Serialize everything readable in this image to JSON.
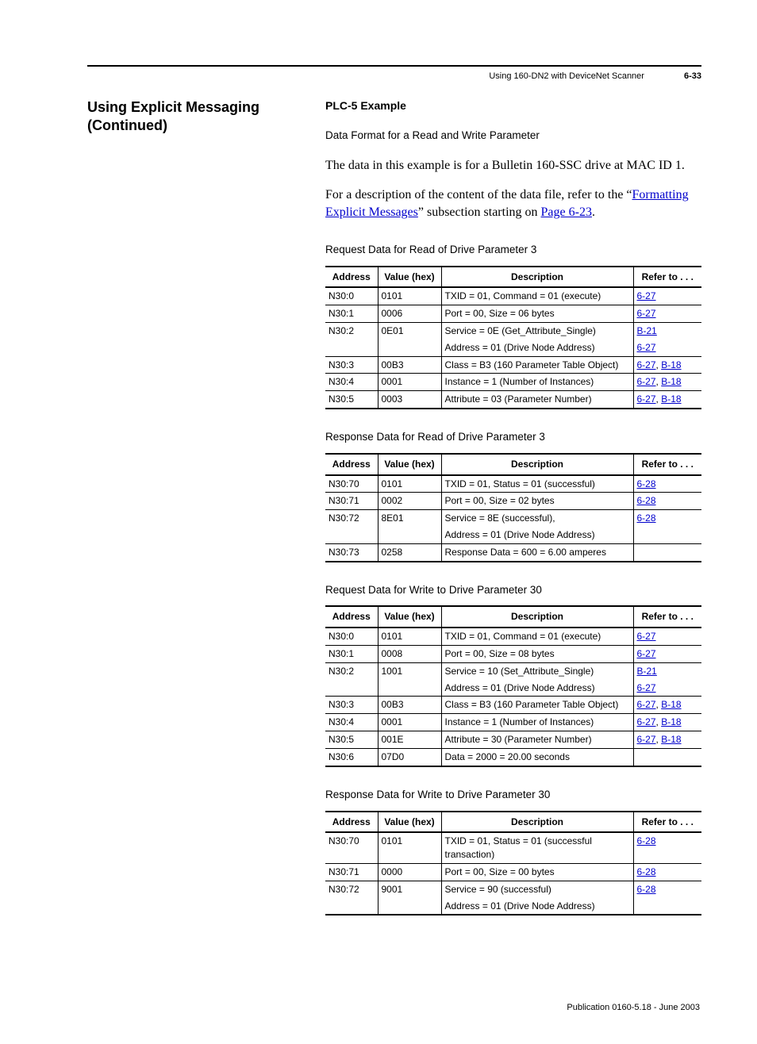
{
  "header": {
    "title": "Using 160-DN2 with DeviceNet Scanner",
    "page_number": "6-33"
  },
  "section_heading": "Using Explicit Messaging (Continued)",
  "subheading": "PLC-5 Example",
  "intro_sans": "Data Format for a Read and Write Parameter",
  "para1": "The data in this example is for a Bulletin 160-SSC drive at MAC ID 1.",
  "para2_pre": "For a description of the content of the data file, refer to the “",
  "para2_link1": "Formatting Explicit Messages",
  "para2_mid": "” subsection starting on ",
  "para2_link2": "Page 6-23",
  "para2_end": ".",
  "col_headers": {
    "address": "Address",
    "value": "Value (hex)",
    "description": "Description",
    "refer": "Refer to . . ."
  },
  "tables": [
    {
      "caption": "Request Data for Read of Drive Parameter 3",
      "rows": [
        {
          "address": "N30:0",
          "value": "0101",
          "description": "TXID = 01, Command = 01 (execute)",
          "refs": [
            "6-27"
          ]
        },
        {
          "address": "N30:1",
          "value": "0006",
          "description": "Port = 00, Size = 06 bytes",
          "refs": [
            "6-27"
          ]
        },
        {
          "address": "N30:2",
          "value": "0E01",
          "description": "Service = 0E (Get_Attribute_Single)",
          "refs": [
            "B-21"
          ]
        },
        {
          "address": "",
          "value": "",
          "description": "Address = 01 (Drive Node Address)",
          "refs": [
            "6-27"
          ],
          "cont": true
        },
        {
          "address": "N30:3",
          "value": "00B3",
          "description": "Class = B3 (160 Parameter Table Object)",
          "refs": [
            "6-27",
            "B-18"
          ]
        },
        {
          "address": "N30:4",
          "value": "0001",
          "description": "Instance = 1 (Number of Instances)",
          "refs": [
            "6-27",
            "B-18"
          ]
        },
        {
          "address": "N30:5",
          "value": "0003",
          "description": "Attribute = 03 (Parameter Number)",
          "refs": [
            "6-27",
            "B-18"
          ]
        }
      ]
    },
    {
      "caption": "Response Data for Read of Drive Parameter 3",
      "rows": [
        {
          "address": "N30:70",
          "value": "0101",
          "description": "TXID = 01, Status = 01 (successful)",
          "refs": [
            "6-28"
          ]
        },
        {
          "address": "N30:71",
          "value": "0002",
          "description": "Port = 00, Size = 02 bytes",
          "refs": [
            "6-28"
          ]
        },
        {
          "address": "N30:72",
          "value": "8E01",
          "description": "Service = 8E (successful),",
          "refs": [
            "6-28"
          ]
        },
        {
          "address": "",
          "value": "",
          "description": "Address = 01 (Drive Node Address)",
          "refs": [],
          "cont": true
        },
        {
          "address": "N30:73",
          "value": "0258",
          "description": "Response Data = 600 = 6.00 amperes",
          "refs": []
        }
      ]
    },
    {
      "caption": "Request Data for Write to Drive Parameter 30",
      "rows": [
        {
          "address": "N30:0",
          "value": "0101",
          "description": "TXID = 01, Command = 01 (execute)",
          "refs": [
            "6-27"
          ]
        },
        {
          "address": "N30:1",
          "value": "0008",
          "description": "Port = 00, Size = 08 bytes",
          "refs": [
            "6-27"
          ]
        },
        {
          "address": "N30:2",
          "value": "1001",
          "description": "Service = 10 (Set_Attribute_Single)",
          "refs": [
            "B-21"
          ]
        },
        {
          "address": "",
          "value": "",
          "description": "Address = 01 (Drive Node Address)",
          "refs": [
            "6-27"
          ],
          "cont": true
        },
        {
          "address": "N30:3",
          "value": "00B3",
          "description": "Class = B3 (160 Parameter Table Object)",
          "refs": [
            "6-27",
            "B-18"
          ]
        },
        {
          "address": "N30:4",
          "value": "0001",
          "description": "Instance = 1 (Number of Instances)",
          "refs": [
            "6-27",
            "B-18"
          ]
        },
        {
          "address": "N30:5",
          "value": "001E",
          "description": "Attribute = 30 (Parameter Number)",
          "refs": [
            "6-27",
            "B-18"
          ]
        },
        {
          "address": "N30:6",
          "value": "07D0",
          "description": "Data = 2000 = 20.00 seconds",
          "refs": []
        }
      ]
    },
    {
      "caption": "Response Data for Write to Drive Parameter 30",
      "rows": [
        {
          "address": "N30:70",
          "value": "0101",
          "description": "TXID = 01, Status = 01 (successful transaction)",
          "refs": [
            "6-28"
          ]
        },
        {
          "address": "N30:71",
          "value": "0000",
          "description": "Port = 00, Size = 00 bytes",
          "refs": [
            "6-28"
          ]
        },
        {
          "address": "N30:72",
          "value": "9001",
          "description": "Service = 90 (successful)",
          "refs": [
            "6-28"
          ]
        },
        {
          "address": "",
          "value": "",
          "description": "Address = 01 (Drive Node Address)",
          "refs": [],
          "cont": true
        }
      ]
    }
  ],
  "footer": "Publication 0160-5.18 - June 2003"
}
